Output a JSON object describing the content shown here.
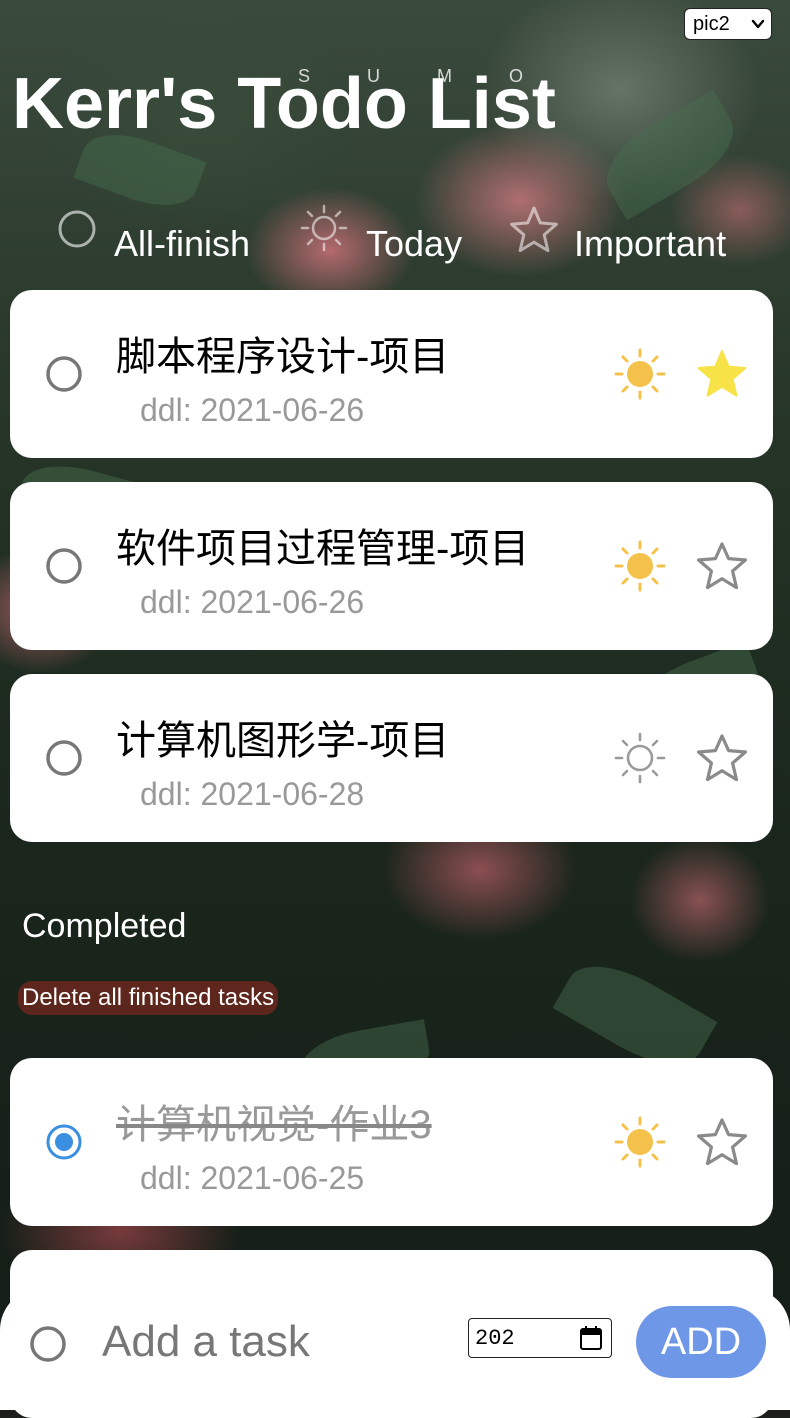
{
  "header": {
    "title": "Kerr's Todo List",
    "ghost_text": "S U M O",
    "background_select": {
      "selected": "pic2"
    }
  },
  "filters": [
    {
      "label": "All-finish",
      "icon": "circle-icon"
    },
    {
      "label": "Today",
      "icon": "sun-icon"
    },
    {
      "label": "Important",
      "icon": "star-icon"
    }
  ],
  "tasks": [
    {
      "name": "脚本程序设计-项目",
      "ddl": "ddl: 2021-06-26",
      "today": true,
      "important": true,
      "done": false
    },
    {
      "name": "软件项目过程管理-项目",
      "ddl": "ddl: 2021-06-26",
      "today": true,
      "important": false,
      "done": false
    },
    {
      "name": "计算机图形学-项目",
      "ddl": "ddl: 2021-06-28",
      "today": false,
      "important": false,
      "done": false
    }
  ],
  "completed": {
    "label": "Completed",
    "delete_label": "Delete all finished tasks",
    "tasks": [
      {
        "name": "计算机视觉-作业3",
        "ddl": "ddl: 2021-06-25",
        "today": true,
        "important": false,
        "done": true
      }
    ]
  },
  "add_bar": {
    "placeholder": "Add a task",
    "date_value": "202",
    "add_label": "ADD"
  },
  "colors": {
    "sun_active": "#f4c14a",
    "sun_inactive": "#9a9a9a",
    "star_active": "#f7e248",
    "star_inactive": "#8a8a8a",
    "radio_checked": "#3b8fe0",
    "add_button": "#6f97e8",
    "delete_bg": "#8c281e"
  }
}
